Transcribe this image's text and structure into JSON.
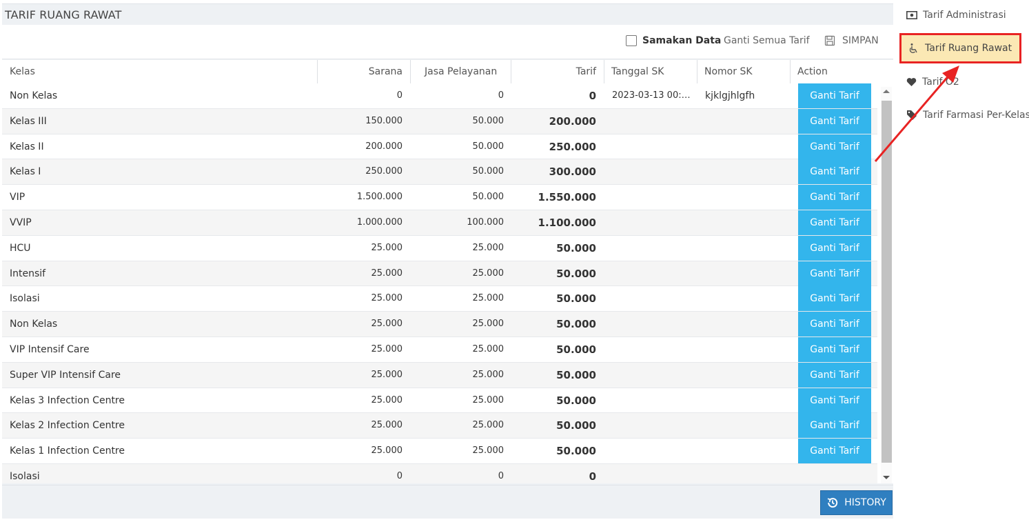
{
  "panel": {
    "title": "TARIF RUANG RAWAT"
  },
  "toolbar": {
    "samakan_label": "Samakan Data",
    "samakan_checked": false,
    "ganti_semua_label": "Ganti Semua Tarif",
    "simpan_label": "SIMPAN"
  },
  "table": {
    "columns": [
      "Kelas",
      "Sarana",
      "Jasa Pelayanan",
      "Tarif",
      "Tanggal SK",
      "Nomor SK",
      "Action"
    ],
    "action_label": "Ganti Tarif",
    "rows": [
      {
        "kelas": "Non Kelas",
        "sarana": "0",
        "jasa": "0",
        "tarif": "0",
        "tanggal_sk": "2023-03-13 00:0...",
        "nomor_sk": "kjklgjhlgfh",
        "action": true
      },
      {
        "kelas": "Kelas III",
        "sarana": "150.000",
        "jasa": "50.000",
        "tarif": "200.000",
        "tanggal_sk": "",
        "nomor_sk": "",
        "action": true
      },
      {
        "kelas": "Kelas II",
        "sarana": "200.000",
        "jasa": "50.000",
        "tarif": "250.000",
        "tanggal_sk": "",
        "nomor_sk": "",
        "action": true
      },
      {
        "kelas": "Kelas I",
        "sarana": "250.000",
        "jasa": "50.000",
        "tarif": "300.000",
        "tanggal_sk": "",
        "nomor_sk": "",
        "action": true
      },
      {
        "kelas": "VIP",
        "sarana": "1.500.000",
        "jasa": "50.000",
        "tarif": "1.550.000",
        "tanggal_sk": "",
        "nomor_sk": "",
        "action": true
      },
      {
        "kelas": "VVIP",
        "sarana": "1.000.000",
        "jasa": "100.000",
        "tarif": "1.100.000",
        "tanggal_sk": "",
        "nomor_sk": "",
        "action": true
      },
      {
        "kelas": "HCU",
        "sarana": "25.000",
        "jasa": "25.000",
        "tarif": "50.000",
        "tanggal_sk": "",
        "nomor_sk": "",
        "action": true
      },
      {
        "kelas": "Intensif",
        "sarana": "25.000",
        "jasa": "25.000",
        "tarif": "50.000",
        "tanggal_sk": "",
        "nomor_sk": "",
        "action": true
      },
      {
        "kelas": "Isolasi",
        "sarana": "25.000",
        "jasa": "25.000",
        "tarif": "50.000",
        "tanggal_sk": "",
        "nomor_sk": "",
        "action": true
      },
      {
        "kelas": "Non Kelas",
        "sarana": "25.000",
        "jasa": "25.000",
        "tarif": "50.000",
        "tanggal_sk": "",
        "nomor_sk": "",
        "action": true
      },
      {
        "kelas": "VIP Intensif Care",
        "sarana": "25.000",
        "jasa": "25.000",
        "tarif": "50.000",
        "tanggal_sk": "",
        "nomor_sk": "",
        "action": true
      },
      {
        "kelas": "Super VIP Intensif Care",
        "sarana": "25.000",
        "jasa": "25.000",
        "tarif": "50.000",
        "tanggal_sk": "",
        "nomor_sk": "",
        "action": true
      },
      {
        "kelas": "Kelas 3 Infection Centre",
        "sarana": "25.000",
        "jasa": "25.000",
        "tarif": "50.000",
        "tanggal_sk": "",
        "nomor_sk": "",
        "action": true
      },
      {
        "kelas": "Kelas 2 Infection Centre",
        "sarana": "25.000",
        "jasa": "25.000",
        "tarif": "50.000",
        "tanggal_sk": "",
        "nomor_sk": "",
        "action": true
      },
      {
        "kelas": "Kelas 1 Infection Centre",
        "sarana": "25.000",
        "jasa": "25.000",
        "tarif": "50.000",
        "tanggal_sk": "",
        "nomor_sk": "",
        "action": true
      },
      {
        "kelas": "Isolasi",
        "sarana": "0",
        "jasa": "0",
        "tarif": "0",
        "tanggal_sk": "",
        "nomor_sk": "",
        "action": false
      }
    ]
  },
  "footer": {
    "history_label": "HISTORY"
  },
  "sidebar": {
    "items": [
      {
        "label": "Tarif Administrasi",
        "icon": "money-icon",
        "active": false
      },
      {
        "label": "Tarif Ruang Rawat",
        "icon": "wheelchair-icon",
        "active": true
      },
      {
        "label": "Tarif O2",
        "icon": "heart-icon",
        "active": false
      },
      {
        "label": "Tarif Farmasi Per-Kelas",
        "icon": "tag-icon",
        "active": false
      }
    ]
  },
  "colors": {
    "action_button": "#33b5ec",
    "history_button": "#2f7fc0",
    "active_item_bg": "#fbe8b4",
    "highlight_red": "#e82323"
  }
}
